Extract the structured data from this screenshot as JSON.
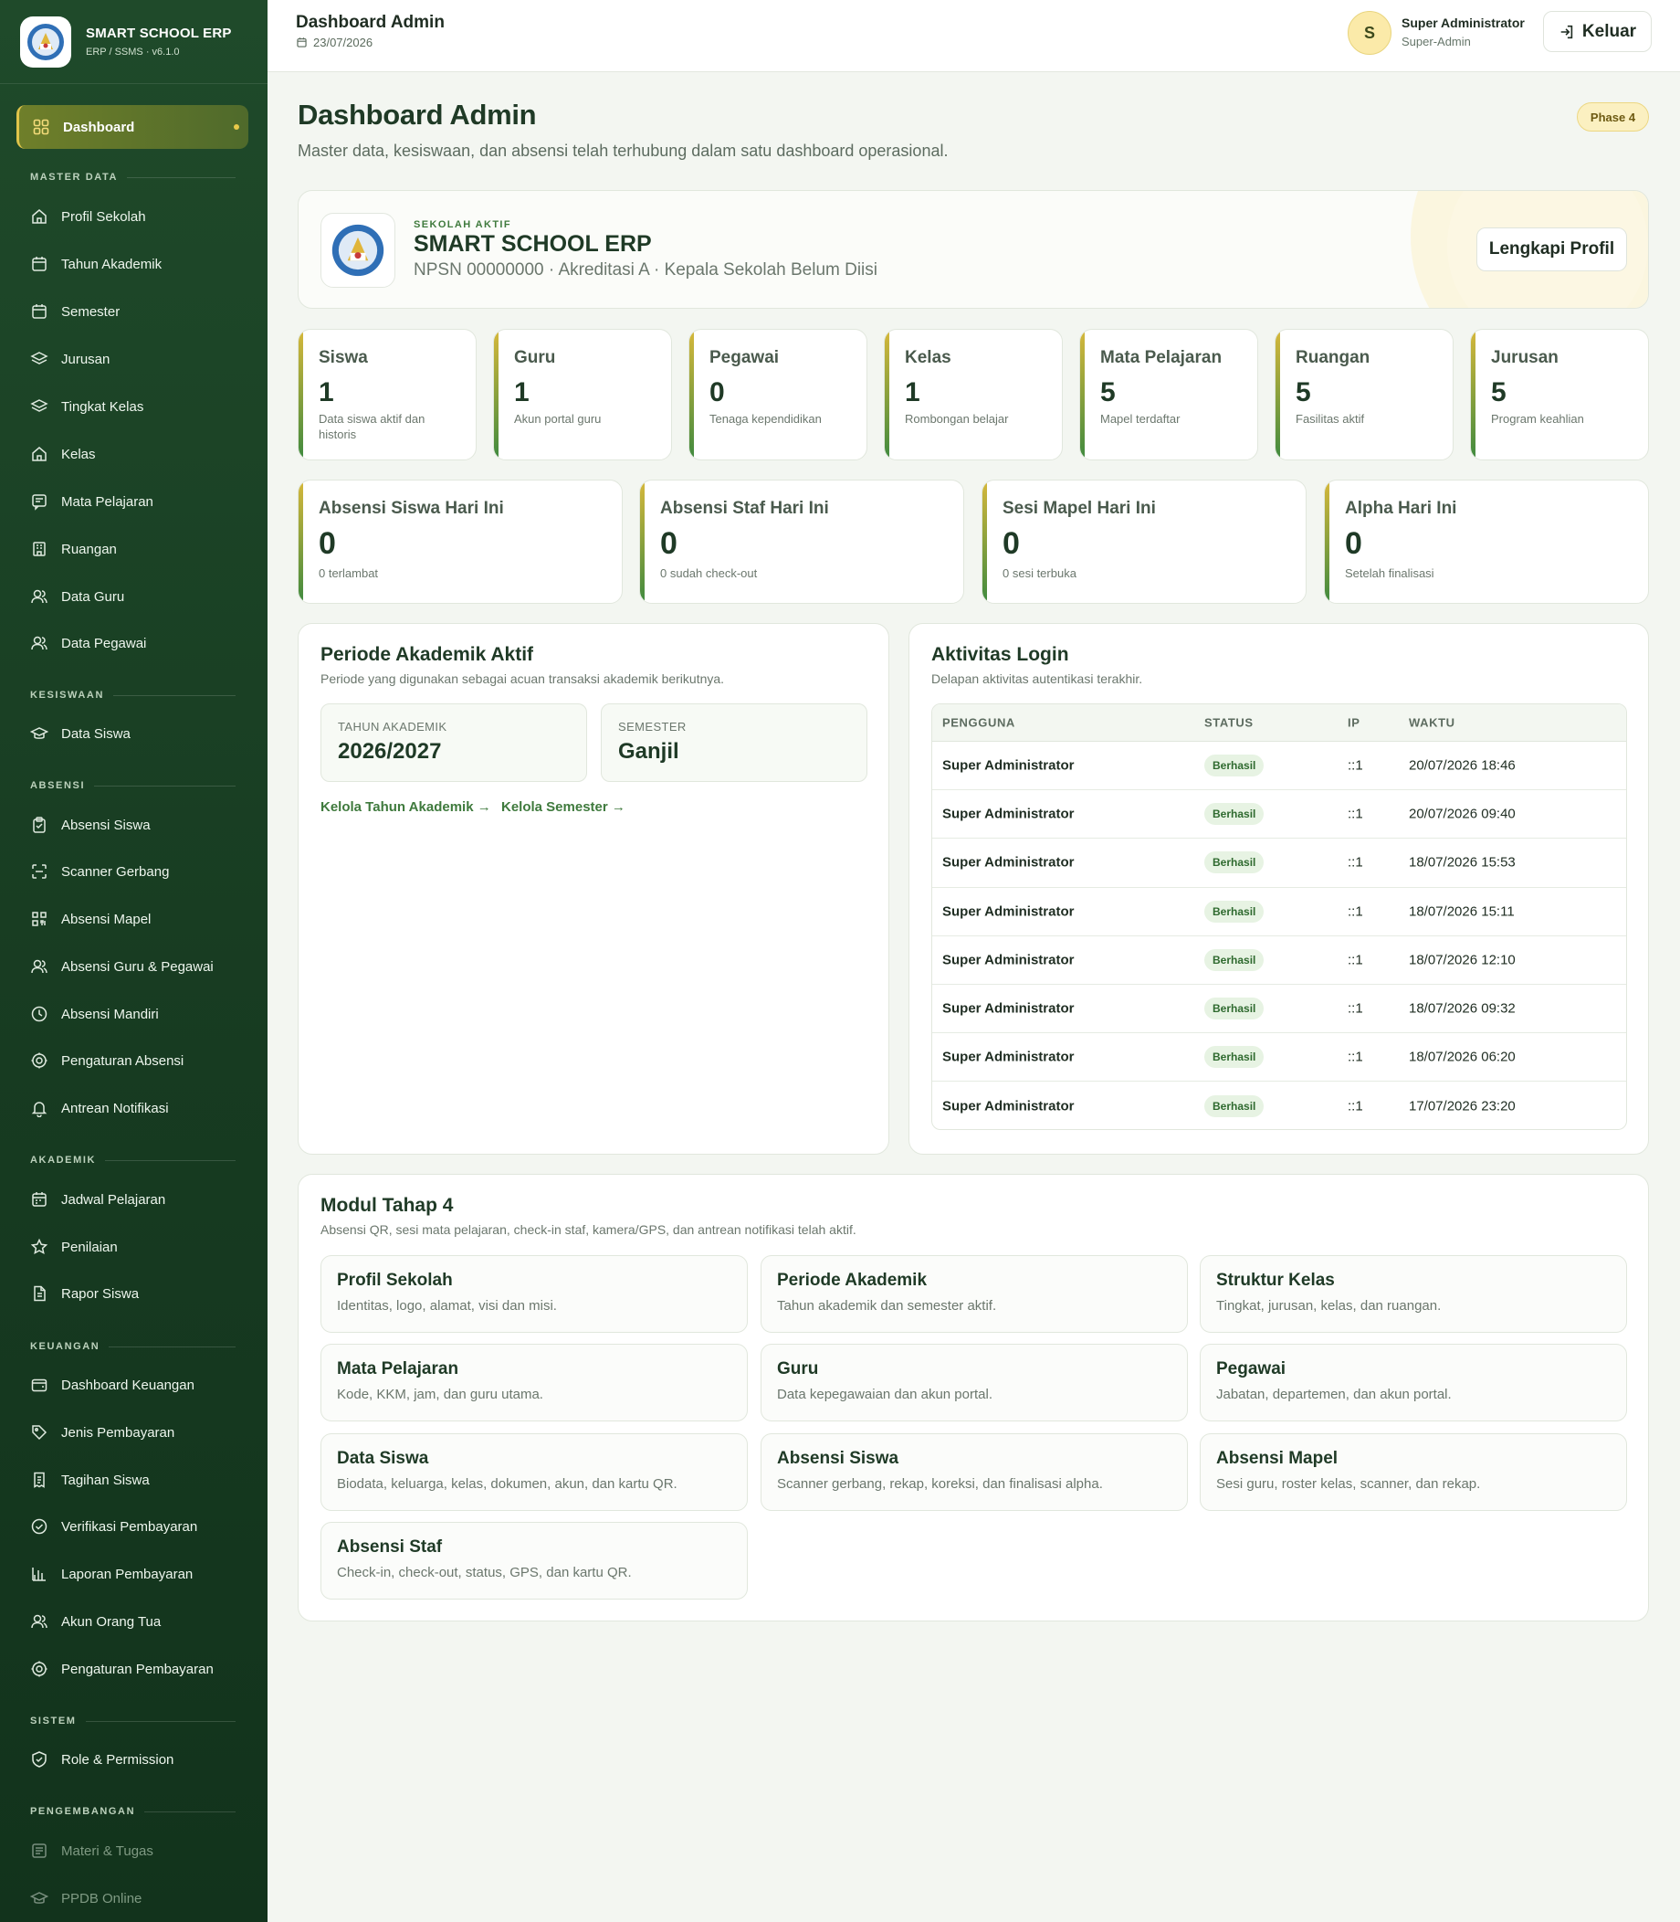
{
  "brand": {
    "title": "SMART SCHOOL ERP",
    "subtitle": "ERP / SSMS · v6.1.0"
  },
  "sidebar": {
    "active": {
      "label": "Dashboard",
      "icon": "grid-icon"
    },
    "sections": [
      {
        "title": "MASTER DATA",
        "items": [
          {
            "label": "Profil Sekolah",
            "icon": "home-icon"
          },
          {
            "label": "Tahun Akademik",
            "icon": "calendar-icon"
          },
          {
            "label": "Semester",
            "icon": "calendar-icon"
          },
          {
            "label": "Jurusan",
            "icon": "layers-icon"
          },
          {
            "label": "Tingkat Kelas",
            "icon": "layers-icon"
          },
          {
            "label": "Kelas",
            "icon": "home-icon"
          },
          {
            "label": "Mata Pelajaran",
            "icon": "message-icon"
          },
          {
            "label": "Ruangan",
            "icon": "building-icon"
          },
          {
            "label": "Data Guru",
            "icon": "user-icon"
          },
          {
            "label": "Data Pegawai",
            "icon": "users-icon"
          }
        ]
      },
      {
        "title": "KESISWAAN",
        "items": [
          {
            "label": "Data Siswa",
            "icon": "graduation-cap-icon"
          }
        ]
      },
      {
        "title": "ABSENSI",
        "items": [
          {
            "label": "Absensi Siswa",
            "icon": "clipboard-icon"
          },
          {
            "label": "Scanner Gerbang",
            "icon": "scan-icon"
          },
          {
            "label": "Absensi Mapel",
            "icon": "qr-icon"
          },
          {
            "label": "Absensi Guru & Pegawai",
            "icon": "users-icon"
          },
          {
            "label": "Absensi Mandiri",
            "icon": "clock-icon"
          },
          {
            "label": "Pengaturan Absensi",
            "icon": "gear-icon"
          },
          {
            "label": "Antrean Notifikasi",
            "icon": "bell-icon"
          }
        ]
      },
      {
        "title": "AKADEMIK",
        "items": [
          {
            "label": "Jadwal Pelajaran",
            "icon": "calendar-icon"
          },
          {
            "label": "Penilaian",
            "icon": "star-icon"
          },
          {
            "label": "Rapor Siswa",
            "icon": "document-icon"
          }
        ]
      },
      {
        "title": "KEUANGAN",
        "items": [
          {
            "label": "Dashboard Keuangan",
            "icon": "wallet-icon"
          },
          {
            "label": "Jenis Pembayaran",
            "icon": "tag-icon"
          },
          {
            "label": "Tagihan Siswa",
            "icon": "receipt-icon"
          },
          {
            "label": "Verifikasi Pembayaran",
            "icon": "check-circle-icon"
          },
          {
            "label": "Laporan Pembayaran",
            "icon": "bar-chart-icon"
          },
          {
            "label": "Akun Orang Tua",
            "icon": "users-icon"
          },
          {
            "label": "Pengaturan Pembayaran",
            "icon": "gear-icon"
          }
        ]
      },
      {
        "title": "SISTEM",
        "items": [
          {
            "label": "Role & Permission",
            "icon": "shield-icon"
          }
        ]
      },
      {
        "title": "PENGEMBANGAN",
        "items": [
          {
            "label": "Materi & Tugas",
            "icon": "message-icon",
            "disabled": true
          },
          {
            "label": "PPDB Online",
            "icon": "graduation-cap-icon",
            "disabled": true
          }
        ]
      }
    ]
  },
  "topbar": {
    "title": "Dashboard Admin",
    "date": "23/07/2026",
    "avatar_initial": "S",
    "user_name": "Super Administrator",
    "user_role": "Super-Admin",
    "logout_label": "Keluar"
  },
  "page": {
    "title": "Dashboard Admin",
    "subtitle": "Master data, kesiswaan, dan absensi telah terhubung dalam satu dashboard operasional.",
    "phase_badge": "Phase 4"
  },
  "school": {
    "eyebrow": "SEKOLAH AKTIF",
    "name": "SMART SCHOOL ERP",
    "meta": "NPSN 00000000 · Akreditasi A · Kepala Sekolah Belum Diisi",
    "button_label": "Lengkapi Profil"
  },
  "stats": [
    {
      "title": "Siswa",
      "value": "1",
      "desc": "Data siswa aktif dan historis"
    },
    {
      "title": "Guru",
      "value": "1",
      "desc": "Akun portal guru"
    },
    {
      "title": "Pegawai",
      "value": "0",
      "desc": "Tenaga kependidikan"
    },
    {
      "title": "Kelas",
      "value": "1",
      "desc": "Rombongan belajar"
    },
    {
      "title": "Mata Pelajaran",
      "value": "5",
      "desc": "Mapel terdaftar"
    },
    {
      "title": "Ruangan",
      "value": "5",
      "desc": "Fasilitas aktif"
    },
    {
      "title": "Jurusan",
      "value": "5",
      "desc": "Program keahlian"
    }
  ],
  "attendance": [
    {
      "title": "Absensi Siswa Hari Ini",
      "value": "0",
      "desc": "0 terlambat"
    },
    {
      "title": "Absensi Staf Hari Ini",
      "value": "0",
      "desc": "0 sudah check-out"
    },
    {
      "title": "Sesi Mapel Hari Ini",
      "value": "0",
      "desc": "0 sesi terbuka"
    },
    {
      "title": "Alpha Hari Ini",
      "value": "0",
      "desc": "Setelah finalisasi"
    }
  ],
  "period": {
    "title": "Periode Akademik Aktif",
    "subtitle": "Periode yang digunakan sebagai acuan transaksi akademik berikutnya.",
    "year_label": "TAHUN AKADEMIK",
    "year_value": "2026/2027",
    "semester_label": "SEMESTER",
    "semester_value": "Ganjil",
    "link_year": "Kelola Tahun Akademik →",
    "link_semester": "Kelola Semester →"
  },
  "login_activity": {
    "title": "Aktivitas Login",
    "subtitle": "Delapan aktivitas autentikasi terakhir.",
    "columns": [
      "PENGGUNA",
      "STATUS",
      "IP",
      "WAKTU"
    ],
    "rows": [
      {
        "user": "Super Administrator",
        "status": "Berhasil",
        "ip": "::1",
        "time": "20/07/2026 18:46"
      },
      {
        "user": "Super Administrator",
        "status": "Berhasil",
        "ip": "::1",
        "time": "20/07/2026 09:40"
      },
      {
        "user": "Super Administrator",
        "status": "Berhasil",
        "ip": "::1",
        "time": "18/07/2026 15:53"
      },
      {
        "user": "Super Administrator",
        "status": "Berhasil",
        "ip": "::1",
        "time": "18/07/2026 15:11"
      },
      {
        "user": "Super Administrator",
        "status": "Berhasil",
        "ip": "::1",
        "time": "18/07/2026 12:10"
      },
      {
        "user": "Super Administrator",
        "status": "Berhasil",
        "ip": "::1",
        "time": "18/07/2026 09:32"
      },
      {
        "user": "Super Administrator",
        "status": "Berhasil",
        "ip": "::1",
        "time": "18/07/2026 06:20"
      },
      {
        "user": "Super Administrator",
        "status": "Berhasil",
        "ip": "::1",
        "time": "17/07/2026 23:20"
      }
    ]
  },
  "modules": {
    "title": "Modul Tahap 4",
    "subtitle": "Absensi QR, sesi mata pelajaran, check-in staf, kamera/GPS, dan antrean notifikasi telah aktif.",
    "items": [
      {
        "title": "Profil Sekolah",
        "desc": "Identitas, logo, alamat, visi dan misi."
      },
      {
        "title": "Periode Akademik",
        "desc": "Tahun akademik dan semester aktif."
      },
      {
        "title": "Struktur Kelas",
        "desc": "Tingkat, jurusan, kelas, dan ruangan."
      },
      {
        "title": "Mata Pelajaran",
        "desc": "Kode, KKM, jam, dan guru utama."
      },
      {
        "title": "Guru",
        "desc": "Data kepegawaian dan akun portal."
      },
      {
        "title": "Pegawai",
        "desc": "Jabatan, departemen, dan akun portal."
      },
      {
        "title": "Data Siswa",
        "desc": "Biodata, keluarga, kelas, dokumen, akun, dan kartu QR."
      },
      {
        "title": "Absensi Siswa",
        "desc": "Scanner gerbang, rekap, koreksi, dan finalisasi alpha."
      },
      {
        "title": "Absensi Mapel",
        "desc": "Sesi guru, roster kelas, scanner, dan rekap."
      },
      {
        "title": "Absensi Staf",
        "desc": "Check-in, check-out, status, GPS, dan kartu QR."
      }
    ]
  }
}
